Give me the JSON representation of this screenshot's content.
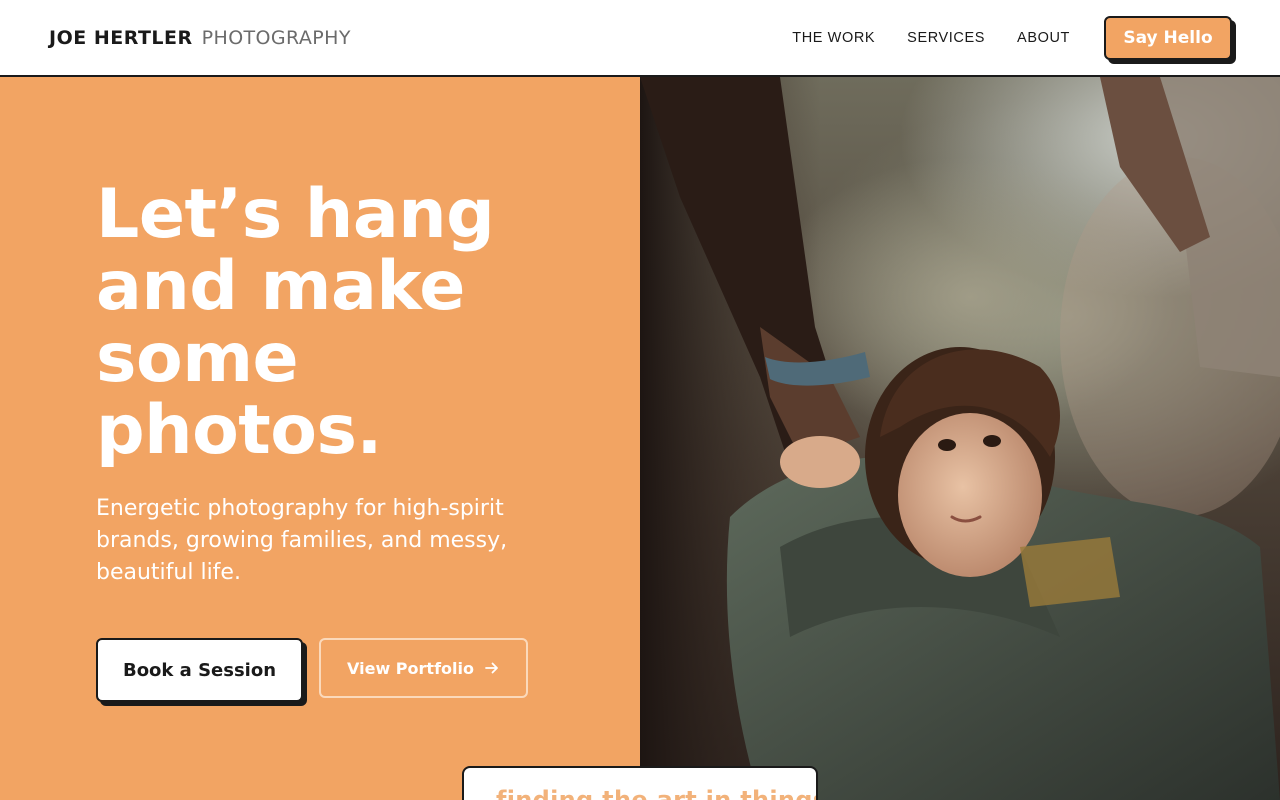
{
  "header": {
    "brand_name": "JOE HERTLER",
    "brand_sub": "PHOTOGRAPHY",
    "nav": [
      "THE WORK",
      "SERVICES",
      "ABOUT"
    ],
    "cta_label": "Say Hello"
  },
  "hero": {
    "headline_lines": [
      "Let’s hang",
      "and make",
      "some",
      "photos."
    ],
    "tagline": "Energetic photography for high-spirit brands, growing families, and messy, beautiful life.",
    "primary_button": "Book a Session",
    "secondary_button": "View Portfolio",
    "secondary_icon": "arrow-right-icon"
  },
  "strip": {
    "text": "finding the art in things"
  },
  "colors": {
    "accent": "#f2a463",
    "ink": "#1a1a1a",
    "white": "#ffffff"
  }
}
